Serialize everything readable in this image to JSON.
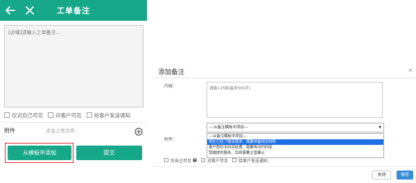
{
  "mobile": {
    "header": {
      "title": "工单备注",
      "back_icon": "arrow-left-icon",
      "close_icon": "close-icon",
      "background": "#17a88a"
    },
    "textarea_placeholder": "[必填]请输入工单备注...",
    "checkboxes": [
      "仅对自己可见",
      "对客户可见",
      "给客户发送通知"
    ],
    "attachment": {
      "label": "附件",
      "hint": "点击上传文件",
      "add_icon": "plus-circle-icon"
    },
    "buttons": {
      "template": "从模板中添加",
      "submit": "提交"
    }
  },
  "dialog": {
    "title": "添加备注",
    "close_symbol": "×",
    "content_label": "内容:",
    "content_placeholder": "请输入内容[最多500字]",
    "select_value": "---从备注模板中添加---",
    "select_arrow": "▼",
    "attachment_label": "附件:",
    "options": [
      "---从备注模板中添加---",
      "我在已经了解该需求，需要准备相关材料",
      "客户暂时无时间处理，需要再次约时间",
      "暂缓提供服务，后续需要主管确认"
    ],
    "selected_index": 1,
    "checkboxes": [
      "仅自己可见",
      "对客户可见",
      "给客户发送通知"
    ],
    "info_symbol": "i",
    "buttons": {
      "close": "关闭",
      "save": "保存"
    },
    "accent": "#3c8dd6"
  }
}
